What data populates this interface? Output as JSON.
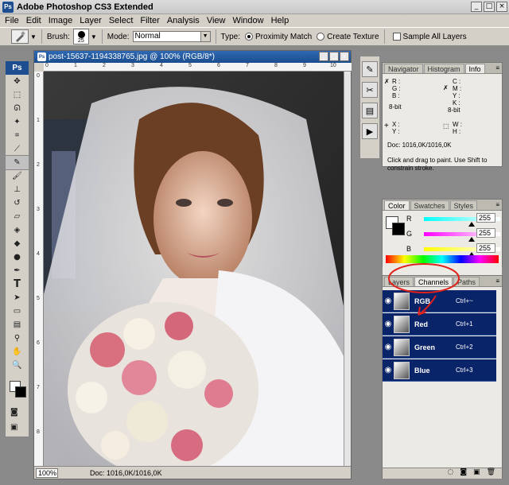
{
  "app": {
    "icon": "Ps",
    "title": "Adobe Photoshop CS3 Extended"
  },
  "window_buttons": [
    "_",
    "□",
    "×"
  ],
  "menu": [
    "File",
    "Edit",
    "Image",
    "Layer",
    "Select",
    "Filter",
    "Analysis",
    "View",
    "Window",
    "Help"
  ],
  "options": {
    "brush_label": "Brush:",
    "brush_size": "25",
    "mode_label": "Mode:",
    "mode_value": "Normal",
    "type_label": "Type:",
    "type_proximity": "Proximity Match",
    "type_texture": "Create Texture",
    "sample_all": "Sample All Layers"
  },
  "toolbox": {
    "header": "Ps"
  },
  "document": {
    "title": "post-15637-1194338765.jpg @ 100% (RGB/8*)",
    "zoom": "100%",
    "doc_size": "Doc: 1016,0K/1016,0K",
    "ruler_h": [
      "0",
      "1",
      "2",
      "3",
      "4",
      "5",
      "6",
      "7",
      "8",
      "9",
      "10"
    ],
    "ruler_v": [
      "0",
      "1",
      "2",
      "3",
      "4",
      "5",
      "6",
      "7",
      "8"
    ]
  },
  "info_panel": {
    "tabs": [
      "Navigator",
      "Histogram",
      "Info"
    ],
    "active": "Info",
    "r": "R :",
    "g": "G :",
    "b": "B :",
    "c": "C :",
    "m": "M :",
    "y": "Y :",
    "k": "K :",
    "bit_left": "8-bit",
    "bit_right": "8-bit",
    "x": "X :",
    "y_coord": "Y :",
    "w": "W :",
    "h": "H :",
    "doc": "Doc: 1016,0K/1016,0K",
    "hint": "Click and drag to paint. Use Shift to constrain stroke."
  },
  "color_panel": {
    "tabs": [
      "Color",
      "Swatches",
      "Styles"
    ],
    "active": "Color",
    "channels": [
      {
        "label": "R",
        "value": "255",
        "gradient_from": "#00ffff",
        "gradient_to": "#ffffff"
      },
      {
        "label": "G",
        "value": "255",
        "gradient_from": "#ff00ff",
        "gradient_to": "#ffffff"
      },
      {
        "label": "B",
        "value": "255",
        "gradient_from": "#ffff00",
        "gradient_to": "#ffffff"
      }
    ]
  },
  "channels_panel": {
    "tabs": [
      "Layers",
      "Channels",
      "Paths"
    ],
    "active": "Channels",
    "rows": [
      {
        "name": "RGB",
        "shortcut": "Ctrl+~"
      },
      {
        "name": "Red",
        "shortcut": "Ctrl+1"
      },
      {
        "name": "Green",
        "shortcut": "Ctrl+2"
      },
      {
        "name": "Blue",
        "shortcut": "Ctrl+3"
      }
    ],
    "footer_icons": [
      "circle-selection-icon",
      "save-selection-icon",
      "new-channel-icon",
      "delete-icon"
    ]
  },
  "colors": {
    "accent": "#0a246a",
    "title_blue": "#1d4e8f",
    "annotation_red": "#e0201a"
  }
}
